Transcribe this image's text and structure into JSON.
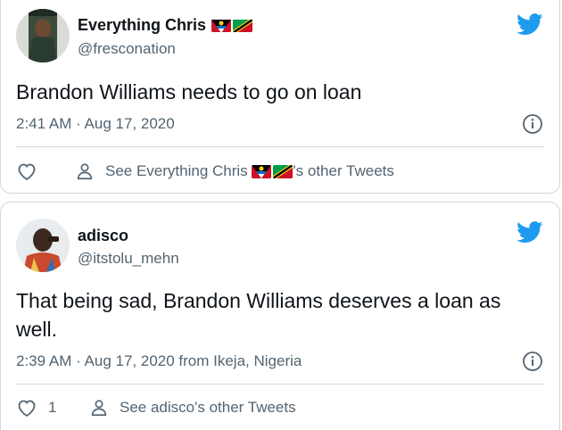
{
  "tweets": [
    {
      "author_name": "Everything Chris",
      "author_flags": [
        "antigua-barbuda-flag",
        "st-kitts-nevis-flag"
      ],
      "handle": "@fresconation",
      "text": "Brandon Williams needs to go on loan",
      "timestamp": "2:41 AM · Aug 17, 2020",
      "like_count": "",
      "other_tweets_prefix": "See Everything Chris ",
      "other_tweets_suffix": "'s other Tweets"
    },
    {
      "author_name": "adisco",
      "handle": "@itstolu_mehn",
      "text": "That being sad, Brandon Williams deserves a loan as well.",
      "timestamp": "2:39 AM · Aug 17, 2020 from Ikeja, Nigeria",
      "like_count": "1",
      "other_tweets": "See adisco's other Tweets"
    }
  ],
  "colors": {
    "twitter_blue": "#1d9bf0",
    "secondary_text": "#536471",
    "border": "#cfd9de"
  }
}
